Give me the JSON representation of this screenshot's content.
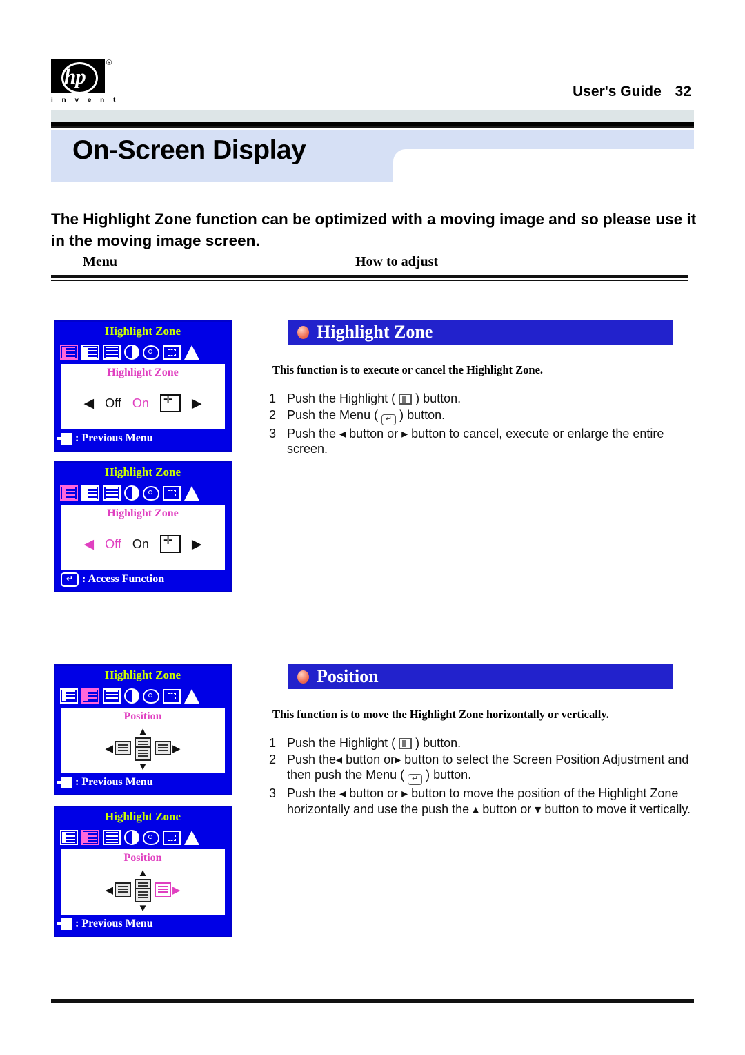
{
  "header": {
    "logo_alt": "hp",
    "logo_wordmark": "i n v e n t",
    "guide_label": "User's Guide",
    "page_number": "32",
    "banner_title": "On-Screen Display"
  },
  "intro": {
    "text": "The Highlight Zone function can be optimized with a moving image and so please use it in the moving image screen.",
    "col_menu": "Menu",
    "col_adjust": "How to adjust"
  },
  "osd_panels": [
    {
      "title": "Highlight Zone",
      "sublabel": "Highlight Zone",
      "option_left": "Off",
      "option_right": "On",
      "selected": "On",
      "footer": ": Previous Menu",
      "footer_icon": "exit-icon",
      "selected_tab": 0
    },
    {
      "title": "Highlight Zone",
      "sublabel": "Highlight Zone",
      "option_left": "Off",
      "option_right": "On",
      "selected": "Off",
      "footer": ": Access Function",
      "footer_icon": "enter-icon",
      "selected_tab": 0
    },
    {
      "title": "Highlight Zone",
      "sublabel": "Position",
      "footer": ": Previous Menu",
      "footer_icon": "exit-icon",
      "selected_tab": 1,
      "highlight_direction": "none"
    },
    {
      "title": "Highlight Zone",
      "sublabel": "Position",
      "footer": ": Previous Menu",
      "footer_icon": "exit-icon",
      "selected_tab": 1,
      "highlight_direction": "right"
    }
  ],
  "sections": [
    {
      "title": "Highlight Zone",
      "description": "This function is to execute or cancel the Highlight Zone.",
      "steps": [
        {
          "num": "1",
          "before": "Push the Highlight (",
          "icon": "highlight-button-icon",
          "after": ") button."
        },
        {
          "num": "2",
          "before": "Push the Menu (",
          "icon": "menu-button-icon",
          "after": ") button."
        },
        {
          "num": "3",
          "before": "Push the ◂  button or ▸  button to cancel, execute or enlarge the entire screen.",
          "icon": "",
          "after": ""
        }
      ]
    },
    {
      "title": "Position",
      "description": "This function is to move the Highlight Zone horizontally or vertically.",
      "steps": [
        {
          "num": "1",
          "before": "Push the Highlight (",
          "icon": "highlight-button-icon",
          "after": ") button."
        },
        {
          "num": "2",
          "before": "Push the◂ button or▸ button to select the Screen Position Adjustment and then push the Menu (",
          "icon": "menu-button-icon",
          "after": ") button."
        },
        {
          "num": "3",
          "before": "Push the ◂  button or ▸  button to move the position of the Highlight Zone horizontally and use the push the ▴  button or ▾  button to move it vertically.",
          "icon": "",
          "after": ""
        }
      ]
    }
  ],
  "colors": {
    "osd_blue": "#0000e6",
    "osd_title_yellow": "#ccff00",
    "osd_pink": "#e040c0",
    "section_bar_blue": "#2222cc",
    "banner_blue": "#d6e0f5",
    "grey_strip": "#dde5e7"
  }
}
